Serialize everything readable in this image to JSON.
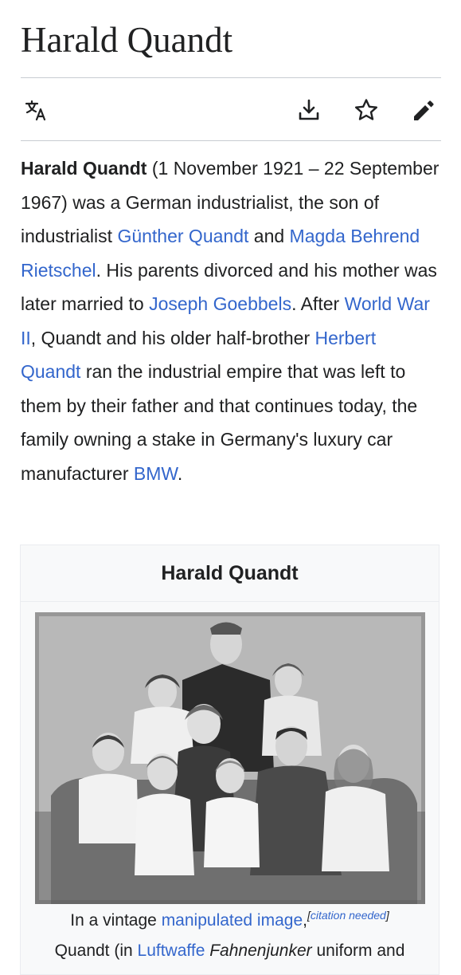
{
  "article": {
    "title": "Harald Quandt"
  },
  "toolbar": {
    "language_icon": "translate-icon",
    "download_icon": "download-icon",
    "watch_icon": "star-icon",
    "edit_icon": "pencil-icon"
  },
  "intro": {
    "subject": "Harald Quandt",
    "t1": " (1 November 1921 – 22 September 1967) was a German industrialist, the son of industrialist ",
    "link1": "Günther Quandt",
    "t2": " and ",
    "link2": "Magda Behrend Rietschel",
    "t3": ". His parents divorced and his mother was later married to ",
    "link3": "Joseph Goebbels",
    "t4": ". After ",
    "link4": "World War II",
    "t5": ", Quandt and his older half-brother ",
    "link5": "Herbert Quandt",
    "t6": " ran the industrial empire that was left to them by their father and that continues today, the family owning a stake in Germany's luxury car manufacturer ",
    "link6": "BMW",
    "t7": "."
  },
  "infobox": {
    "title": "Harald Quandt",
    "caption_t1": "In a vintage ",
    "caption_link1": "manipulated image",
    "caption_t2": ",",
    "citation_open": "[",
    "citation_text": "citation needed",
    "citation_close": "]",
    "caption_t3": "Quandt (in ",
    "caption_link2": "Luftwaffe",
    "caption_t4": " ",
    "caption_italic": "Fahnenjunker",
    "caption_t5": " uniform and"
  },
  "colors": {
    "link": "#3366cc",
    "text": "#202122",
    "divider": "#c8ccd1",
    "infobox_bg": "#f8f9fa"
  }
}
